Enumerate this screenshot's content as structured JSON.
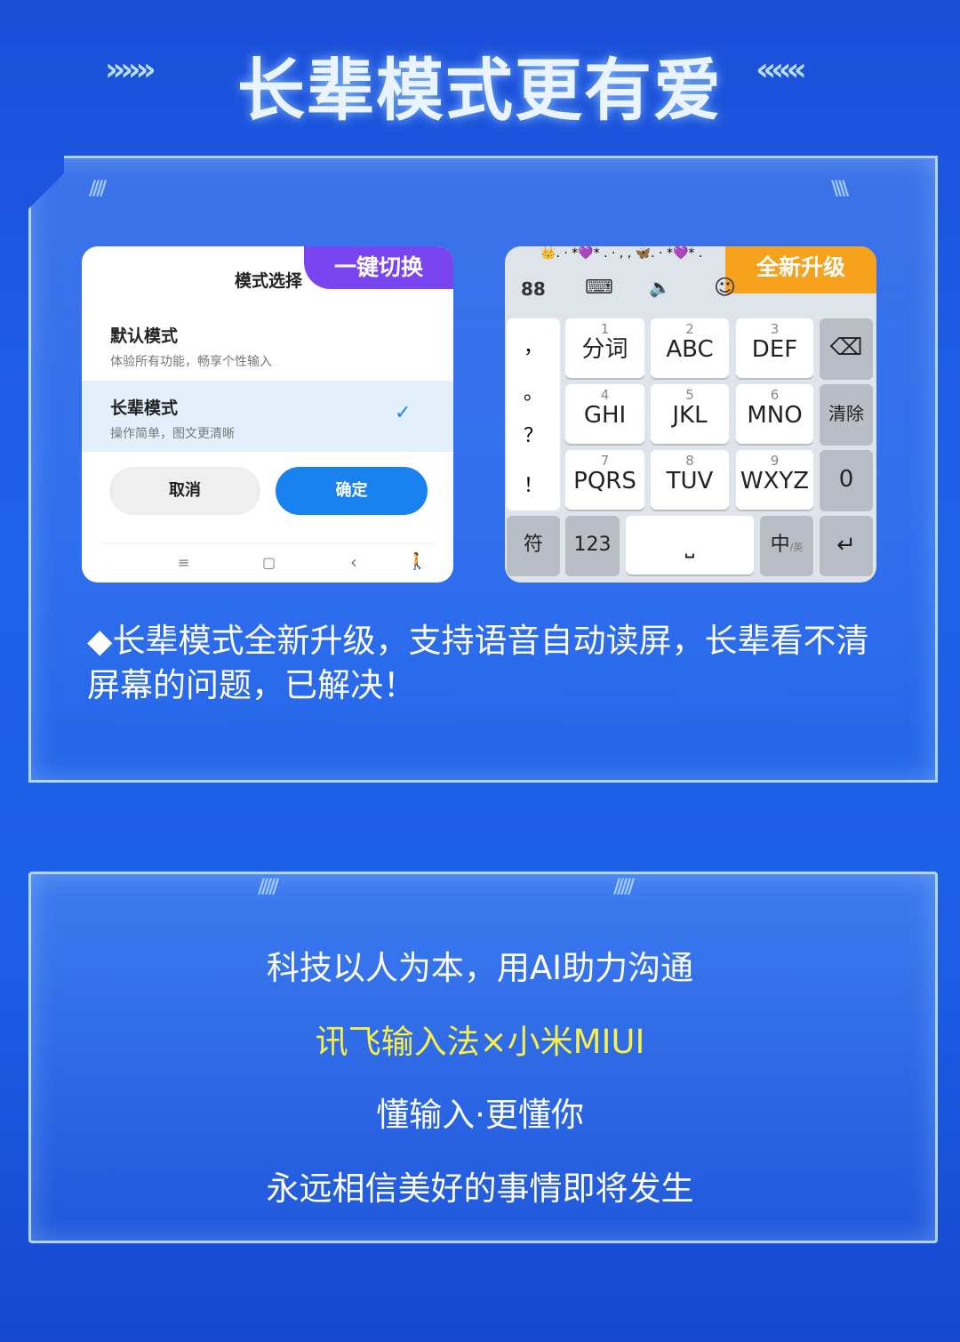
{
  "title": "长辈模式更有爱",
  "title_deco_left": "»»»",
  "title_deco_right": "«««",
  "left_card": {
    "badge": "一键切换",
    "badge_color": "#7a45f0",
    "dialog_title": "模式选择",
    "options": [
      {
        "title": "默认模式",
        "desc": "体验所有功能，畅享个性输入",
        "selected": false
      },
      {
        "title": "长辈模式",
        "desc": "操作简单，图文更清晰",
        "selected": true
      }
    ],
    "check": "✓",
    "cancel": "取消",
    "confirm": "确定",
    "confirm_color": "#1a82f0",
    "nav": [
      "≡",
      "▢",
      "‹",
      "🚶"
    ]
  },
  "right_card": {
    "badge": "全新升级",
    "badge_color": "#f7a21d",
    "emoji_strip": "👑. · *💜* . · , , 🦋. · *💜* .",
    "toolbar": [
      "88",
      "⌨",
      "🔈",
      "☺"
    ],
    "side_keys": [
      "，",
      "。",
      "？",
      "！"
    ],
    "keys": [
      {
        "num": "1",
        "label": "分词"
      },
      {
        "num": "2",
        "label": "ABC"
      },
      {
        "num": "3",
        "label": "DEF"
      },
      {
        "num": "4",
        "label": "GHI"
      },
      {
        "num": "5",
        "label": "JKL"
      },
      {
        "num": "6",
        "label": "MNO"
      },
      {
        "num": "7",
        "label": "PQRS"
      },
      {
        "num": "8",
        "label": "TUV"
      },
      {
        "num": "9",
        "label": "WXYZ"
      }
    ],
    "right_keys": [
      "⌫",
      "清除",
      "0"
    ],
    "bottom": {
      "sym": "符",
      "num": "123",
      "space": "⎵",
      "lang": "中",
      "lang_sub": "/英",
      "enter": "↵"
    }
  },
  "caption": "◆长辈模式全新升级，支持语音自动读屏，长辈看不清屏幕的问题，已解决！",
  "closing": {
    "lines": [
      "科技以人为本，用AI助力沟通",
      "讯飞输入法×小米MIUI",
      "懂输入·更懂你",
      "永远相信美好的事情即将发生"
    ],
    "highlight_color": "#f7ef4a"
  }
}
